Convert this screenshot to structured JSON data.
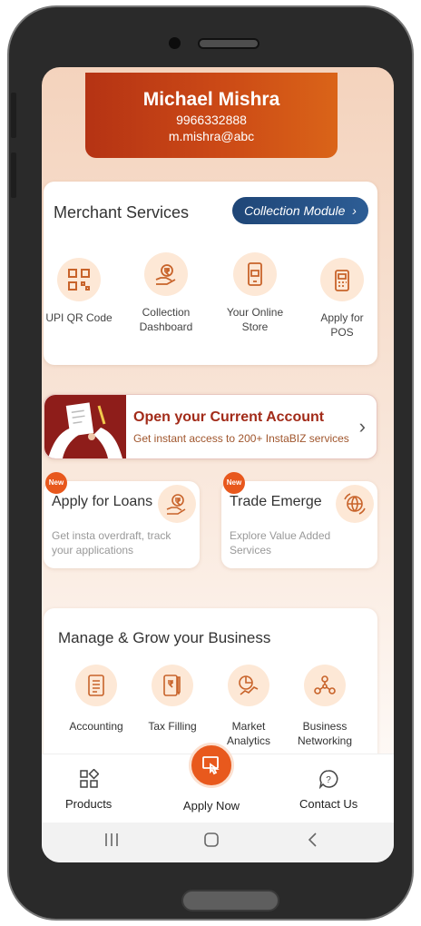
{
  "profile": {
    "name": "Michael Mishra",
    "phone": "9966332888",
    "email": "m.mishra@abc"
  },
  "merchant_services": {
    "title": "Merchant Services",
    "collection_button": "Collection Module",
    "services": [
      {
        "label": "UPI QR Code",
        "icon": "qr-code-icon"
      },
      {
        "label": "Collection Dashboard",
        "icon": "rupee-hand-icon"
      },
      {
        "label": "Your Online Store",
        "icon": "phone-store-icon"
      },
      {
        "label": "Apply for POS",
        "icon": "pos-terminal-icon"
      }
    ]
  },
  "current_account": {
    "title": "Open your Current Account",
    "subtitle": "Get instant access to 200+ InstaBIZ services"
  },
  "loans": {
    "badge": "New",
    "title": "Apply for Loans",
    "subtitle": "Get insta overdraft, track your applications"
  },
  "trade": {
    "badge": "New",
    "title": "Trade Emerge",
    "subtitle": "Explore Value Added Services"
  },
  "manage": {
    "title": "Manage & Grow your Business",
    "items": [
      {
        "label": "Accounting",
        "icon": "ledger-icon"
      },
      {
        "label": "Tax Filling",
        "icon": "tax-document-icon"
      },
      {
        "label": "Market Analytics",
        "icon": "analytics-icon"
      },
      {
        "label": "Business Networking",
        "icon": "network-icon"
      }
    ]
  },
  "bottom_nav": {
    "products": "Products",
    "apply_now": "Apply Now",
    "contact_us": "Contact Us"
  },
  "colors": {
    "accent": "#e8591d",
    "profile_bg": "#c0401a",
    "collection_button": "#24507f"
  }
}
